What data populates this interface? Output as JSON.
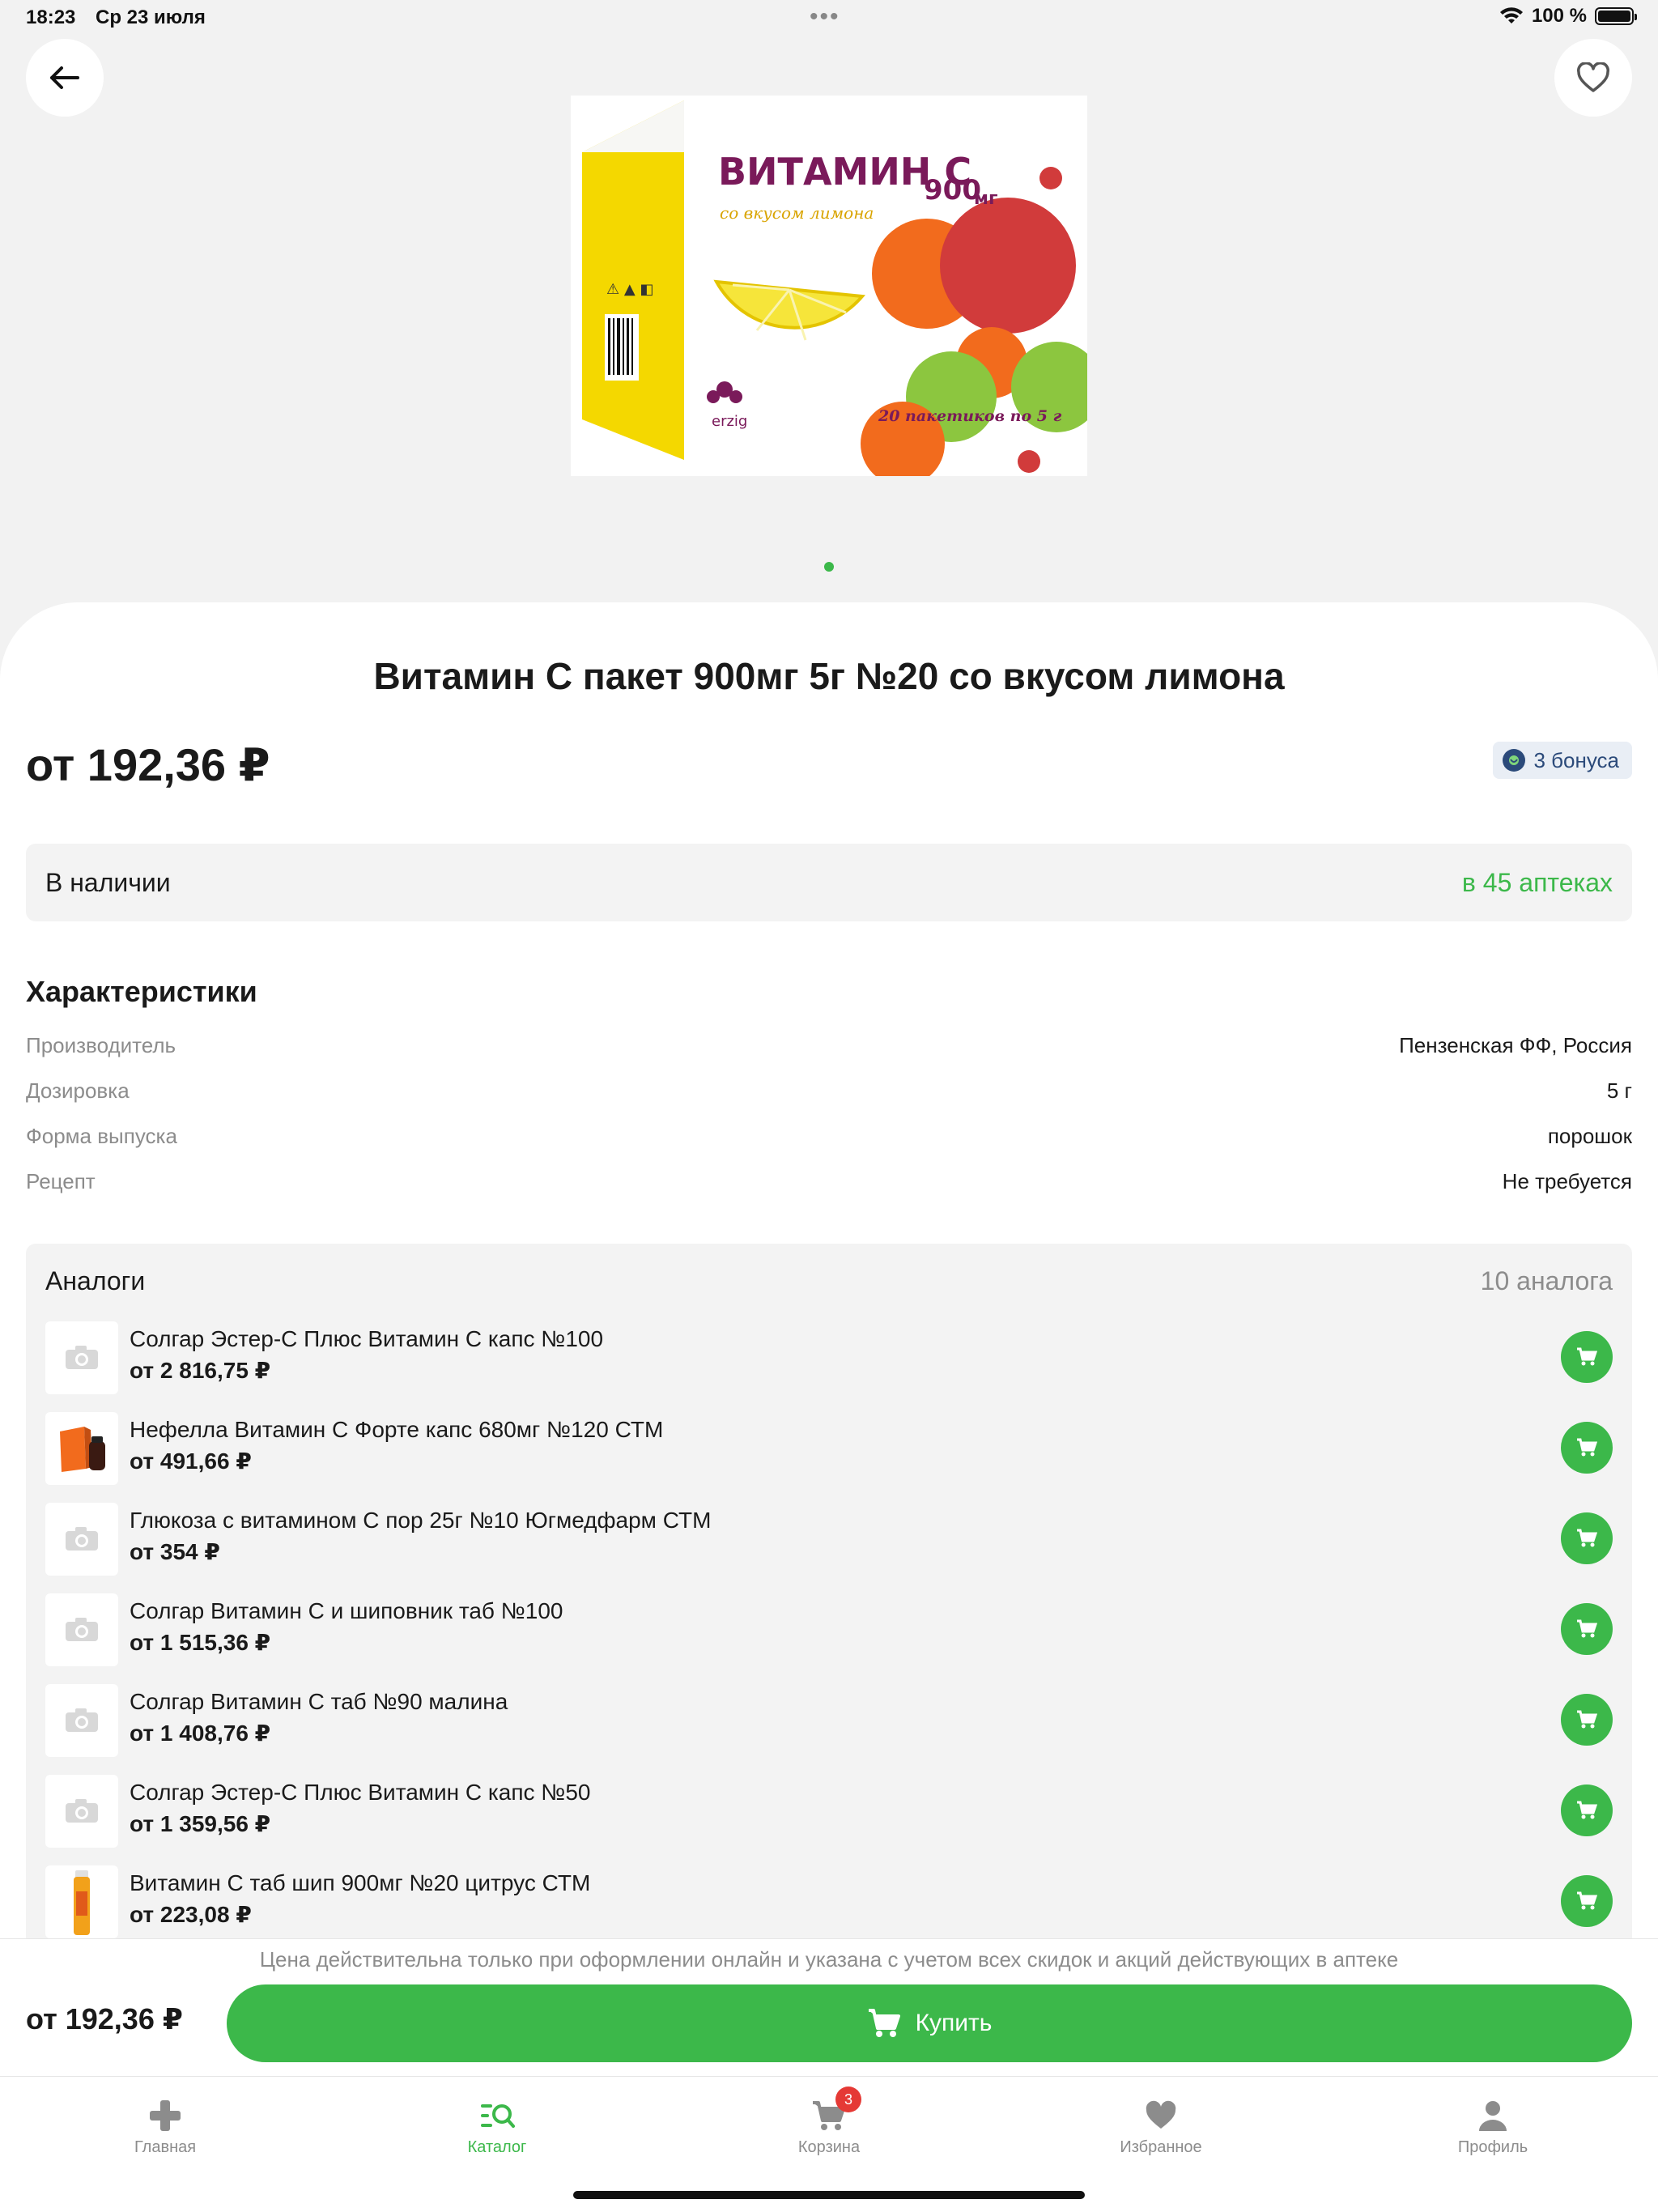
{
  "status_bar": {
    "time": "18:23",
    "date": "Ср 23 июля",
    "battery": "100 %"
  },
  "product": {
    "title": "Витамин С пакет 900мг 5г №20 со вкусом лимона",
    "price": "от 192,36 ₽",
    "bonus": "3 бонуса",
    "image": {
      "brand_title": "ВИТАМИН С",
      "dose": "900",
      "dose_unit": "мг",
      "flavor": "со вкусом лимона",
      "count": "20 пакетиков по 5 г",
      "maker_logo": "erzig"
    }
  },
  "stock": {
    "label": "В наличии",
    "link": "в 45 аптеках"
  },
  "characteristics": {
    "title": "Характеристики",
    "rows": [
      {
        "key": "Производитель",
        "value": "Пензенская ФФ, Россия"
      },
      {
        "key": "Дозировка",
        "value": "5 г"
      },
      {
        "key": "Форма выпуска",
        "value": "порошок"
      },
      {
        "key": "Рецепт",
        "value": "Не требуется"
      }
    ]
  },
  "analogs": {
    "title": "Аналоги",
    "count": "10 аналога",
    "items": [
      {
        "name": "Солгар Эстер-С Плюс Витамин С капс №100",
        "price": "от 2 816,75 ₽",
        "thumb": "placeholder"
      },
      {
        "name": "Нефелла Витамин С Форте капс 680мг №120 СТМ",
        "price": "от 491,66 ₽",
        "thumb": "box-bottle"
      },
      {
        "name": "Глюкоза с витамином С пор 25г №10 Югмедфарм СТМ",
        "price": "от 354 ₽",
        "thumb": "placeholder"
      },
      {
        "name": "Солгар Витамин С и шиповник таб №100",
        "price": "от 1 515,36 ₽",
        "thumb": "placeholder"
      },
      {
        "name": "Солгар Витамин С таб №90 малина",
        "price": "от 1 408,76 ₽",
        "thumb": "placeholder"
      },
      {
        "name": "Солгар Эстер-С Плюс Витамин С капс №50",
        "price": "от 1 359,56 ₽",
        "thumb": "placeholder"
      },
      {
        "name": "Витамин С таб шип 900мг №20 цитрус СТМ",
        "price": "от 223,08 ₽",
        "thumb": "tube"
      }
    ]
  },
  "buy_bar": {
    "note": "Цена действительна только при оформлении онлайн и указана с учетом всех скидок и акций действующих в аптеке",
    "price": "от 192,36 ₽",
    "button": "Купить"
  },
  "tab_bar": {
    "tabs": [
      {
        "label": "Главная",
        "icon": "plus-icon"
      },
      {
        "label": "Каталог",
        "icon": "catalog-search-icon",
        "active": true
      },
      {
        "label": "Корзина",
        "icon": "cart-icon",
        "badge": "3"
      },
      {
        "label": "Избранное",
        "icon": "heart-icon"
      },
      {
        "label": "Профиль",
        "icon": "profile-icon"
      }
    ]
  },
  "colors": {
    "accent": "#3cb84a",
    "badge": "#e53935",
    "bonus_text": "#2b4a7a"
  }
}
